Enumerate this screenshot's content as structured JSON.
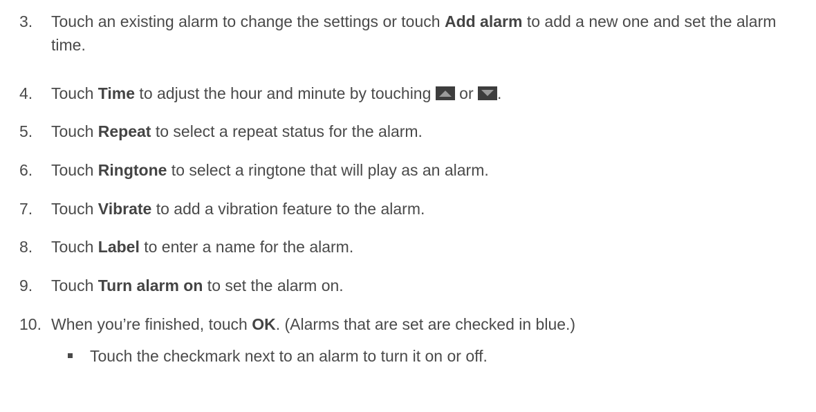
{
  "steps": [
    {
      "number": "3.",
      "parts": [
        "Touch an existing alarm to change the settings or touch ",
        "Add alarm",
        " to add a new one and set the alarm time."
      ]
    },
    {
      "number": "4.",
      "parts": [
        "Touch ",
        "Time",
        " to adjust the hour and minute by touching ",
        " or ",
        "."
      ],
      "icons": [
        "arrow-up-icon",
        "arrow-down-icon"
      ]
    },
    {
      "number": "5.",
      "parts": [
        "Touch ",
        "Repeat",
        " to select a repeat status for the alarm."
      ]
    },
    {
      "number": "6.",
      "parts": [
        "Touch ",
        "Ringtone",
        " to select a ringtone that will play as an alarm."
      ]
    },
    {
      "number": "7.",
      "parts": [
        "Touch ",
        "Vibrate",
        " to add a vibration feature to the alarm."
      ]
    },
    {
      "number": "8.",
      "parts": [
        "Touch ",
        "Label",
        " to enter a name for the alarm."
      ]
    },
    {
      "number": "9.",
      "parts": [
        "Touch ",
        "Turn alarm on",
        " to set the alarm on."
      ]
    },
    {
      "number": "10.",
      "parts": [
        "When you’re finished, touch ",
        "OK",
        ". (Alarms that are set are checked in blue.)"
      ]
    }
  ],
  "bullets": [
    "Touch the checkmark next to an alarm to turn it on or off."
  ],
  "colors": {
    "text": "#4a4a4a",
    "icon_bg": "#3d3d3d",
    "icon_arrow": "#9a9a9a"
  }
}
